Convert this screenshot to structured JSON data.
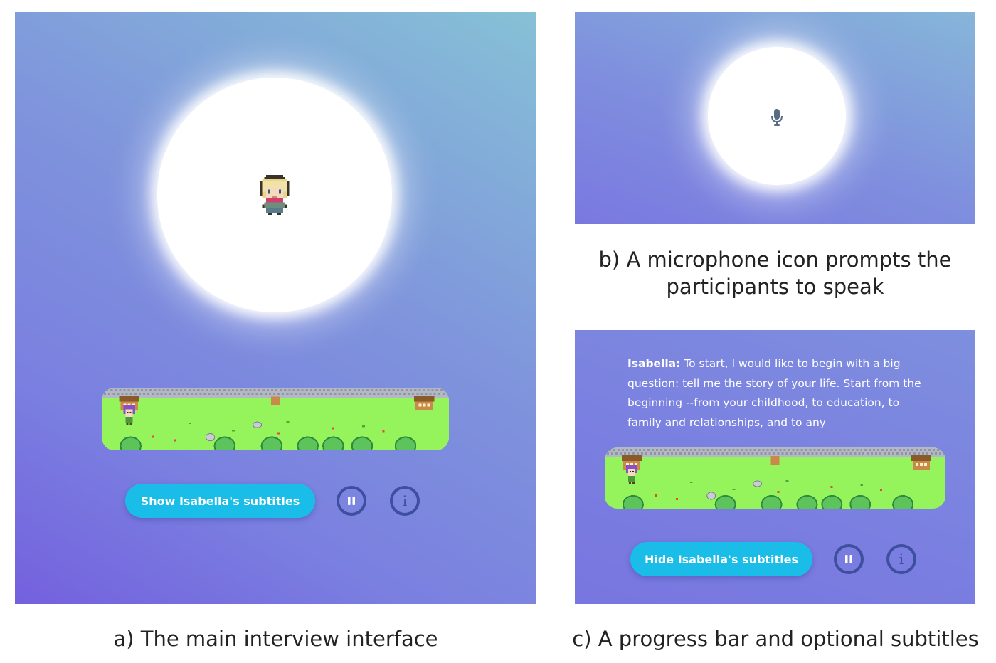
{
  "panel_a": {
    "caption": "a) The main interview interface",
    "subtitle_toggle_label": "Show Isabella's subtitles",
    "progress_fraction": 0.05
  },
  "panel_b": {
    "caption_line1": "b) A microphone icon prompts the",
    "caption_line2": "participants to speak"
  },
  "panel_c": {
    "caption": "c) A progress bar and optional subtitles",
    "subtitle_speaker": "Isabella:",
    "subtitle_text": "To start, I would like to begin with a big question: tell me the story of your life. Start from the beginning --from your childhood, to education, to family and relationships, and to any",
    "subtitle_toggle_label": "Hide Isabella's subtitles",
    "progress_fraction": 0.05
  },
  "icons": {
    "avatar": "interviewer-avatar-icon",
    "microphone": "microphone-icon",
    "pause": "pause-icon",
    "info": "info-icon",
    "progress_character": "pixel-character-icon"
  },
  "colors": {
    "button_accent": "#19bde8",
    "round_button_border": "#3e4fa0",
    "progress_grass": "#95f45c"
  }
}
